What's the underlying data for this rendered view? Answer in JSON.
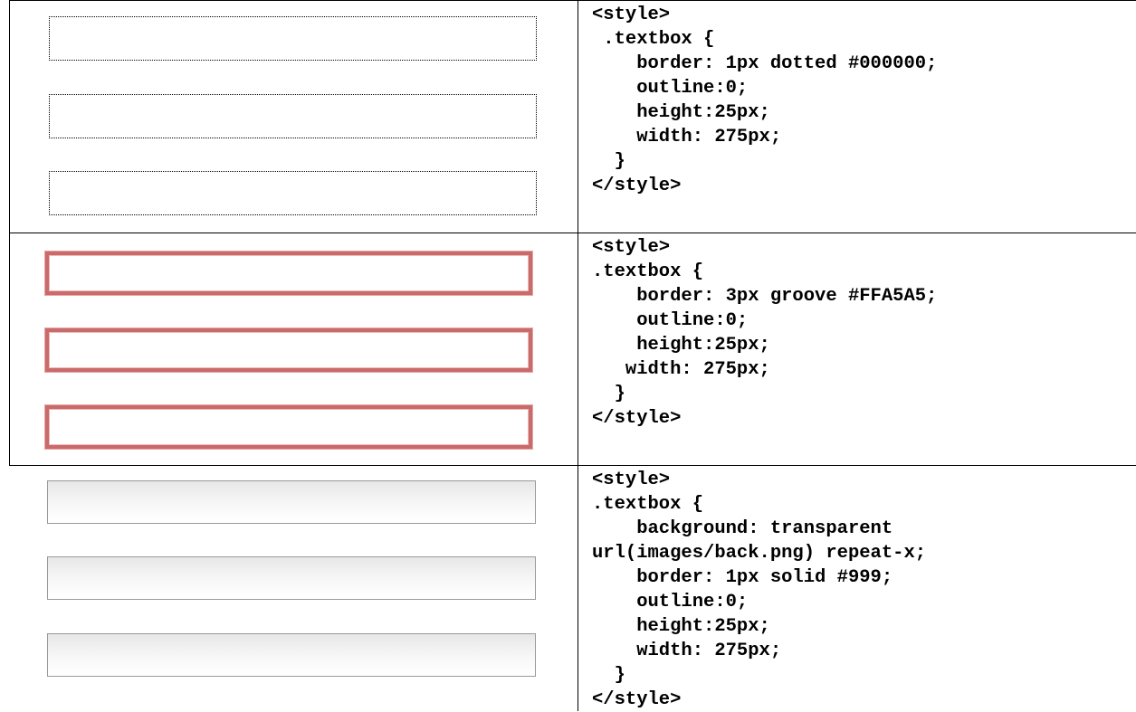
{
  "rows": [
    {
      "style": "dotted",
      "code_lines": [
        "<style>",
        " .textbox {",
        "    border: 1px dotted #000000;",
        "    outline:0;",
        "    height:25px;",
        "    width: 275px;",
        "  }",
        "</style>"
      ]
    },
    {
      "style": "groove",
      "code_lines": [
        "<style>",
        ".textbox {",
        "    border: 3px groove #FFA5A5;",
        "    outline:0;",
        "    height:25px;",
        "   width: 275px;",
        "  }",
        "</style>"
      ]
    },
    {
      "style": "gradient",
      "code_lines": [
        "<style>",
        ".textbox {",
        "    background: transparent",
        "url(images/back.png) repeat-x;",
        "    border: 1px solid #999;",
        "    outline:0;",
        "    height:25px;",
        "    width: 275px;",
        "  }",
        "</style>"
      ]
    }
  ]
}
